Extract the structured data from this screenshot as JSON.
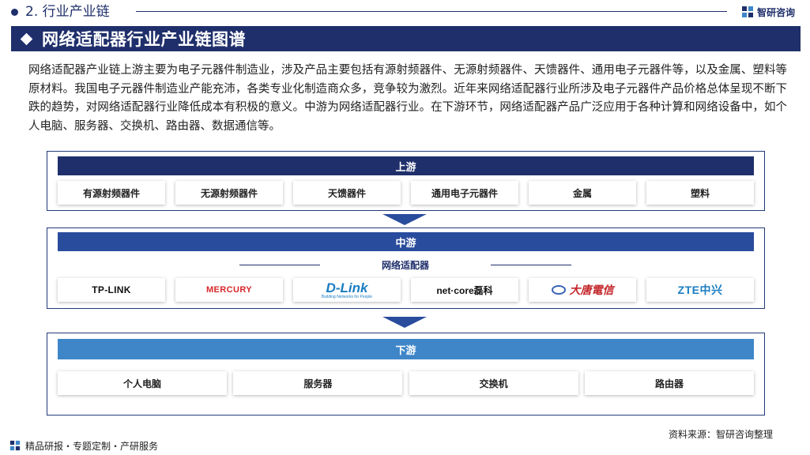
{
  "header": {
    "section_label": "2. 行业产业链",
    "brand_name": "智研咨询"
  },
  "title": "网络适配器行业产业链图谱",
  "intro": "网络适配器产业链上游主要为电子元器件制造业，涉及产品主要包括有源射频器件、无源射频器件、天馈器件、通用电子元器件等，以及金属、塑料等原材料。我国电子元器件制造业产能充沛，各类专业化制造商众多，竞争较为激烈。近年来网络适配器行业所涉及电子元器件产品价格总体呈现不断下跌的趋势，对网络适配器行业降低成本有积极的意义。中游为网络适配器行业。在下游环节，网络适配器产品广泛应用于各种计算和网络设备中，如个人电脑、服务器、交换机、路由器、数据通信等。",
  "upstream": {
    "label": "上游",
    "items": [
      "有源射频器件",
      "无源射频器件",
      "天馈器件",
      "通用电子元器件",
      "金属",
      "塑料"
    ]
  },
  "midstream": {
    "label": "中游",
    "sub_label": "网络适配器",
    "brands": {
      "tplink": "TP-LINK",
      "mercury": "MERCURY",
      "dlink": "D-Link",
      "dlink_tagline": "Building Networks for People",
      "netcore": "net·core磊科",
      "datang": "大唐電信",
      "zte": "ZTE中兴"
    }
  },
  "downstream": {
    "label": "下游",
    "items": [
      "个人电脑",
      "服务器",
      "交换机",
      "路由器"
    ]
  },
  "footer": {
    "tagline": "精品研报・专题定制・产研服务",
    "source": "资料来源：智研咨询整理"
  },
  "colors": {
    "navy": "#1f2f6b",
    "mid_blue": "#2a4c9d",
    "light_blue": "#3f86c9"
  }
}
